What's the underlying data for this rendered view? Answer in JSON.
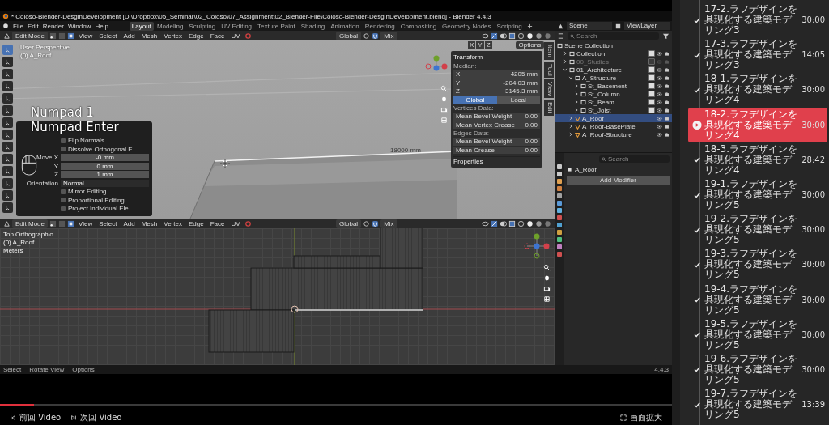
{
  "blender": {
    "title": "* Coloso-Blender-DesginDevelopment [D:\\Dropbox\\05_Seminar\\02_Coloso\\07_Assignment\\02_Blender-File\\Coloso-Blender-DesginDevelopment.blend] - Blender 4.4.3",
    "menus": [
      "File",
      "Edit",
      "Render",
      "Window",
      "Help"
    ],
    "workspace_tabs": [
      {
        "label": "Layout",
        "selected": true
      },
      {
        "label": "Modeling",
        "selected": false
      },
      {
        "label": "Sculpting",
        "selected": false
      },
      {
        "label": "UV Editing",
        "selected": false
      },
      {
        "label": "Texture Paint",
        "selected": false
      },
      {
        "label": "Shading",
        "selected": false
      },
      {
        "label": "Animation",
        "selected": false
      },
      {
        "label": "Rendering",
        "selected": false
      },
      {
        "label": "Compositing",
        "selected": false
      },
      {
        "label": "Geometry Nodes",
        "selected": false
      },
      {
        "label": "Scripting",
        "selected": false
      }
    ],
    "scene": "Scene",
    "view_layer": "ViewLayer",
    "viewports": [
      {
        "kind": "perspective",
        "header": {
          "mode": "Edit Mode",
          "menus": [
            "View",
            "Select",
            "Add",
            "Mesh",
            "Vertex",
            "Edge",
            "Face",
            "UV"
          ],
          "orientation": "Global",
          "snap": "Mix"
        },
        "axis_toggles": [
          "X",
          "Y",
          "Z"
        ],
        "options": "Options",
        "info": [
          "User Perspective",
          "(0) A_Roof"
        ],
        "key_overlay": [
          "Numpad 1",
          "Numpad Enter"
        ],
        "dimension": "18000 mm",
        "tools": [
          {
            "selected": true
          },
          {
            "selected": false
          },
          {
            "selected": false
          },
          {
            "selected": false
          },
          {
            "selected": false
          },
          {
            "selected": false
          },
          {
            "selected": false
          },
          {
            "selected": false
          },
          {
            "selected": false
          },
          {
            "selected": false
          },
          {
            "selected": false
          },
          {
            "selected": false
          },
          {
            "selected": false
          },
          {
            "selected": false
          }
        ],
        "operator_panel": [
          {
            "kind": "checkbox",
            "label": "Flip Normals",
            "checked": false
          },
          {
            "kind": "checkbox",
            "label": "Dissolve Orthogonal E...",
            "checked": false
          },
          {
            "kind": "number",
            "label": "Move X",
            "value": "-0 mm"
          },
          {
            "kind": "number",
            "label": "Y",
            "value": "0 mm"
          },
          {
            "kind": "number",
            "label": "Z",
            "value": "1 mm"
          },
          {
            "kind": "dropdown",
            "label": "Orientation",
            "value": "Normal"
          },
          {
            "kind": "checkbox",
            "label": "Mirror Editing",
            "checked": false
          },
          {
            "kind": "checkbox",
            "label": "Proportional Editing",
            "checked": false
          },
          {
            "kind": "checkbox",
            "label": "Project Individual Ele...",
            "checked": false
          }
        ],
        "n_panel": {
          "title": "Transform",
          "median": "Median:",
          "fields": [
            {
              "label": "X",
              "value": "4205 mm"
            },
            {
              "label": "Y",
              "value": "-204.03 mm"
            },
            {
              "label": "Z",
              "value": "3145.3 mm"
            }
          ],
          "space": [
            {
              "label": "Global",
              "selected": true
            },
            {
              "label": "Local",
              "selected": false
            }
          ],
          "sections": [
            {
              "title": "Vertices Data:",
              "fields": [
                {
                  "label": "Mean Bevel Weight",
                  "value": "0.00"
                },
                {
                  "label": "Mean Vertex Crease",
                  "value": "0.00"
                }
              ]
            },
            {
              "title": "Edges Data:",
              "fields": [
                {
                  "label": "Mean Bevel Weight",
                  "value": "0.00"
                },
                {
                  "label": "Mean Crease",
                  "value": "0.00"
                }
              ]
            }
          ],
          "properties": "Properties"
        },
        "side_tabs": [
          "Item",
          "Tool",
          "View",
          "Edit"
        ]
      },
      {
        "kind": "orthographic",
        "header": {
          "mode": "Edit Mode",
          "menus": [
            "View",
            "Select",
            "Add",
            "Mesh",
            "Vertex",
            "Edge",
            "Face",
            "UV"
          ],
          "orientation": "Global",
          "snap": "Mix"
        },
        "info": [
          "Top Orthographic",
          "(0) A_Roof",
          "Meters"
        ]
      }
    ],
    "outliner": {
      "search_placeholder": "Search",
      "tree": [
        {
          "label": "Scene Collection",
          "kind": "root",
          "selected": false,
          "children": [
            {
              "label": "Collection",
              "kind": "collection",
              "checked": true,
              "disabled": false,
              "selected": false,
              "expanded": false
            },
            {
              "label": "00_Studies",
              "kind": "collection",
              "checked": false,
              "disabled": true,
              "selected": false,
              "expanded": false
            },
            {
              "label": "01_Architecture",
              "kind": "collection",
              "checked": true,
              "disabled": false,
              "selected": false,
              "expanded": true,
              "children": [
                {
                  "label": "A_Structure",
                  "kind": "collection",
                  "checked": true,
                  "disabled": false,
                  "selected": false,
                  "expanded": true,
                  "children": [
                    {
                      "label": "St_Basement",
                      "kind": "collection",
                      "checked": true,
                      "disabled": false,
                      "selected": false,
                      "expanded": false
                    },
                    {
                      "label": "St_Column",
                      "kind": "collection",
                      "checked": true,
                      "disabled": false,
                      "selected": false,
                      "expanded": false
                    },
                    {
                      "label": "St_Beam",
                      "kind": "collection",
                      "checked": true,
                      "disabled": false,
                      "selected": false,
                      "expanded": false
                    },
                    {
                      "label": "St_Joist",
                      "kind": "collection",
                      "checked": true,
                      "disabled": false,
                      "selected": false,
                      "expanded": false
                    }
                  ]
                },
                {
                  "label": "A_Roof",
                  "kind": "object",
                  "disabled": false,
                  "selected": true,
                  "expanded": false
                },
                {
                  "label": "A_Roof-BasePlate",
                  "kind": "object",
                  "disabled": false,
                  "selected": false,
                  "expanded": false
                },
                {
                  "label": "A_Roof-Structure",
                  "kind": "object",
                  "disabled": false,
                  "selected": false,
                  "expanded": false
                }
              ]
            }
          ]
        }
      ]
    },
    "properties": {
      "search_placeholder": "Search",
      "object": "A_Roof",
      "add_modifier": "Add Modifier"
    },
    "status_bar": {
      "items": [
        "Select",
        "Rotate View",
        "Options"
      ],
      "version": "4.4.3"
    }
  },
  "player": {
    "progress": {
      "level": 0.05
    },
    "prev": "前回 Video",
    "next": "次回 Video",
    "fullscreen": "画面拡大"
  },
  "playlist": [
    {
      "title": "17-2.ラフデザインを具現化する建築モデリング3",
      "duration": "30:00",
      "done": true,
      "selected": false
    },
    {
      "title": "17-3.ラフデザインを具現化する建築モデリング3",
      "duration": "14:05",
      "done": true,
      "selected": false
    },
    {
      "title": "18-1.ラフデザインを具現化する建築モデリング4",
      "duration": "30:00",
      "done": true,
      "selected": false
    },
    {
      "title": "18-2.ラフデザインを具現化する建築モデリング4",
      "duration": "30:00",
      "done": false,
      "selected": true
    },
    {
      "title": "18-3.ラフデザインを具現化する建築モデリング4",
      "duration": "28:42",
      "done": true,
      "selected": false
    },
    {
      "title": "19-1.ラフデザインを具現化する建築モデリング5",
      "duration": "30:00",
      "done": true,
      "selected": false
    },
    {
      "title": "19-2.ラフデザインを具現化する建築モデリング5",
      "duration": "30:00",
      "done": true,
      "selected": false
    },
    {
      "title": "19-3.ラフデザインを具現化する建築モデリング5",
      "duration": "30:00",
      "done": true,
      "selected": false
    },
    {
      "title": "19-4.ラフデザインを具現化する建築モデリング5",
      "duration": "30:00",
      "done": true,
      "selected": false
    },
    {
      "title": "19-5.ラフデザインを具現化する建築モデリング5",
      "duration": "30:00",
      "done": true,
      "selected": false
    },
    {
      "title": "19-6.ラフデザインを具現化する建築モデリング5",
      "duration": "30:00",
      "done": true,
      "selected": false
    },
    {
      "title": "19-7.ラフデザインを具現化する建築モデリング5",
      "duration": "13:39",
      "done": true,
      "selected": false
    }
  ]
}
